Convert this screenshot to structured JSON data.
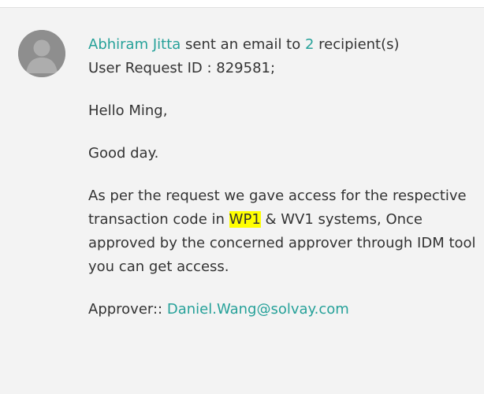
{
  "activity": {
    "sender_name": "Abhiram Jitta",
    "sent_text": " sent an email to ",
    "recipient_count": "2",
    "recipient_suffix": " recipient(s)"
  },
  "email": {
    "request_line": "User Request ID : 829581;",
    "greeting": "Hello Ming,",
    "good_day": "Good day.",
    "body_before_highlight": "As per the request we gave access for the respective transaction code in ",
    "highlighted_term": "WP1",
    "body_after_highlight": " & WV1 systems, Once approved by the concerned approver through IDM tool you can get access.",
    "approver_label": "Approver:: ",
    "approver_email": "Daniel.Wang@solvay.com"
  },
  "colors": {
    "link": "#26a199",
    "highlight": "#ffff00",
    "card_background": "#f3f3f3",
    "avatar": "#8e8e8e"
  },
  "icons": {
    "avatar": "default-user-avatar-icon"
  }
}
